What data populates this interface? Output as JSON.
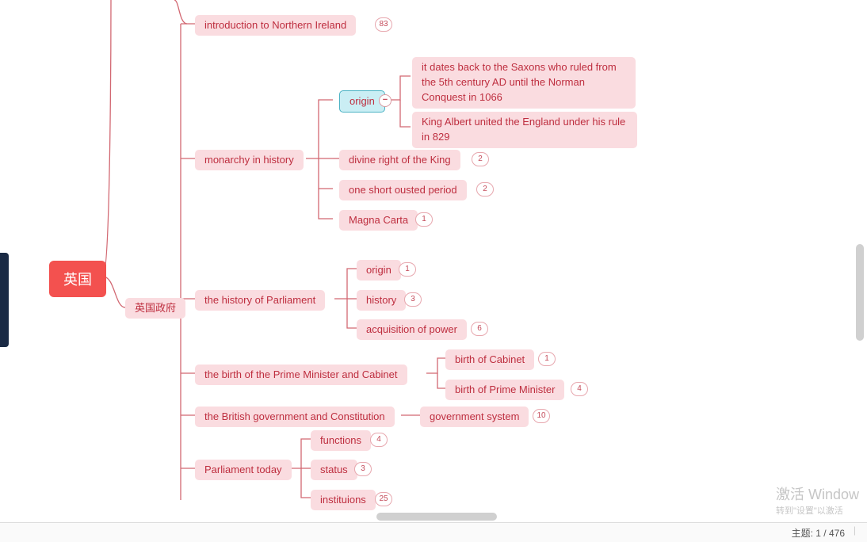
{
  "root": "英国",
  "branch_node": "英国政府",
  "children": [
    {
      "label": "introduction to Northern Ireland",
      "badge": "83"
    },
    {
      "label": "monarchy in history",
      "sub": [
        {
          "label": "origin",
          "selected": true,
          "leaves": [
            {
              "label": "it dates back to the Saxons who ruled from the 5th century AD until the Norman Conquest in 1066"
            },
            {
              "label": "King Albert united the England under his rule in 829"
            }
          ]
        },
        {
          "label": "divine right of the King",
          "badge": "2"
        },
        {
          "label": "one short ousted period",
          "badge": "2"
        },
        {
          "label": "Magna Carta",
          "badge": "1"
        }
      ]
    },
    {
      "label": "the history of Parliament",
      "sub": [
        {
          "label": "origin",
          "badge": "1"
        },
        {
          "label": "history",
          "badge": "3"
        },
        {
          "label": "acquisition of power",
          "badge": "6"
        }
      ]
    },
    {
      "label": "the birth of the Prime Minister and Cabinet",
      "sub": [
        {
          "label": "birth of Cabinet",
          "badge": "1"
        },
        {
          "label": "birth of Prime Minister",
          "badge": "4"
        }
      ]
    },
    {
      "label": "the British government and Constitution",
      "sub": [
        {
          "label": "government system",
          "badge": "10"
        }
      ]
    },
    {
      "label": "Parliament today",
      "sub": [
        {
          "label": "functions",
          "badge": "4"
        },
        {
          "label": "status",
          "badge": "3"
        },
        {
          "label": "instituions",
          "badge": "25"
        }
      ]
    }
  ],
  "status_prefix": "主题: ",
  "status_current": "1",
  "status_sep": " / ",
  "status_total": "476",
  "watermark_line1": "激活 Window",
  "watermark_line2": "转到\"设置\"以激活",
  "collapse_symbol": "−"
}
